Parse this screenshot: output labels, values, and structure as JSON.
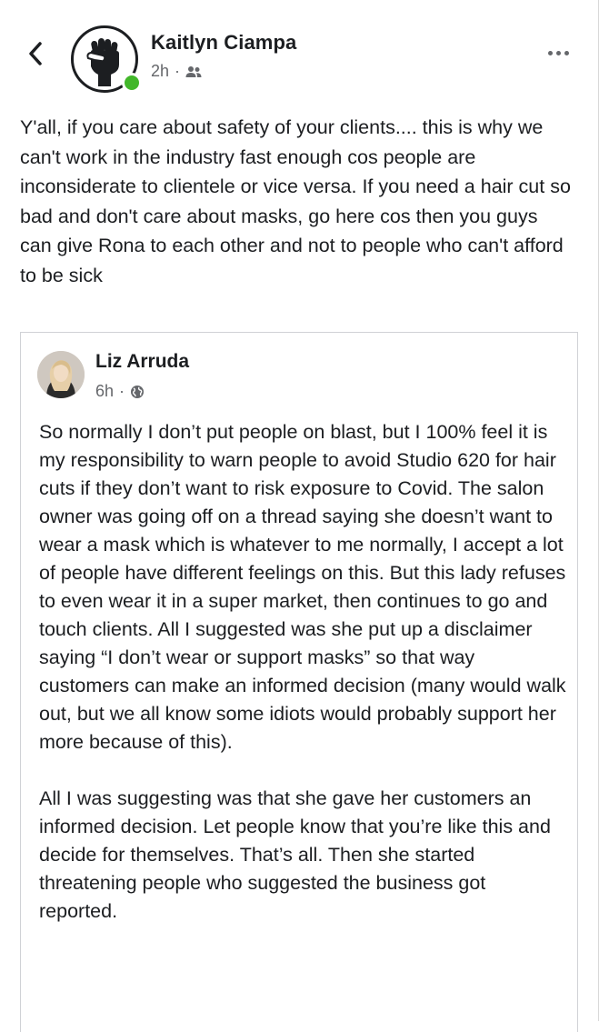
{
  "post": {
    "author": "Kaitlyn Ciampa",
    "time": "2h",
    "separator": "·",
    "audience_icon": "friends-icon",
    "back_icon": "chevron-left-icon",
    "more_icon": "more-horizontal-icon",
    "online_color": "#42b72a",
    "text": "Y'all, if you care about safety of your clients.... this is why we can't work in the industry fast enough cos people are inconsiderate to clientele or vice versa. If you need a hair cut so bad and don't care about masks, go here cos then you guys can give Rona to each other and not to people who can't afford to be sick"
  },
  "shared": {
    "author": "Liz Arruda",
    "time": "6h",
    "separator": "·",
    "audience_icon": "globe-icon",
    "paragraphs": [
      "So normally I don’t put people on blast, but I 100% feel it is my responsibility to warn people to avoid Studio 620 for hair cuts if they don’t want to risk exposure to Covid. The salon owner was going off on a thread saying she doesn’t want to wear a mask which is whatever to me normally, I accept a lot of people have different feelings on this. But this lady refuses to even wear it in a super market, then continues to go and touch clients. All I suggested was she put up a disclaimer saying “I don’t wear or support masks” so that way customers can make an informed decision (many would walk out, but we all know some idiots would probably support her more because of this).",
      "All I was suggesting was that she gave her customers an informed decision. Let people know that you’re like this and decide for themselves. That’s all. Then she started threatening people who suggested the business got reported."
    ]
  }
}
